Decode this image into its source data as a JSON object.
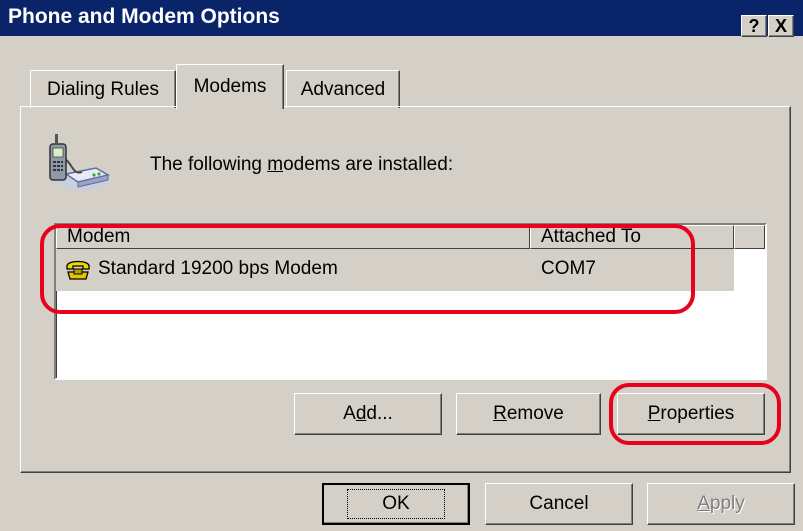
{
  "window": {
    "title": "Phone and Modem Options"
  },
  "caption_buttons": {
    "help": "?",
    "close": "X"
  },
  "tabs": [
    {
      "label": "Dialing Rules",
      "active": false
    },
    {
      "label": "Modems",
      "active": true
    },
    {
      "label": "Advanced",
      "active": false
    }
  ],
  "modems_page": {
    "description_prefix": "The following ",
    "description_mnemonic": "m",
    "description_suffix": "odems are  installed:",
    "columns": [
      "Modem",
      "Attached To"
    ],
    "rows": [
      {
        "modem": "Standard 19200 bps Modem",
        "attached_to": "COM7",
        "icon": "modem-phone-icon",
        "selected": true
      }
    ],
    "buttons": {
      "add": {
        "before": "A",
        "mnemonic": "d",
        "after": "d..."
      },
      "remove": {
        "before": "",
        "mnemonic": "R",
        "after": "emove"
      },
      "properties": {
        "before": "",
        "mnemonic": "P",
        "after": "roperties"
      }
    }
  },
  "dialog_buttons": {
    "ok": "OK",
    "cancel": "Cancel",
    "apply": {
      "before": "",
      "mnemonic": "A",
      "after": "pply",
      "disabled": true
    }
  },
  "icons": {
    "header": "phone-modem-icon",
    "row": "modem-phone-icon"
  },
  "colors": {
    "title_bar": "#0a246a",
    "face": "#d4d0c8",
    "annotation": "#e8001c"
  }
}
